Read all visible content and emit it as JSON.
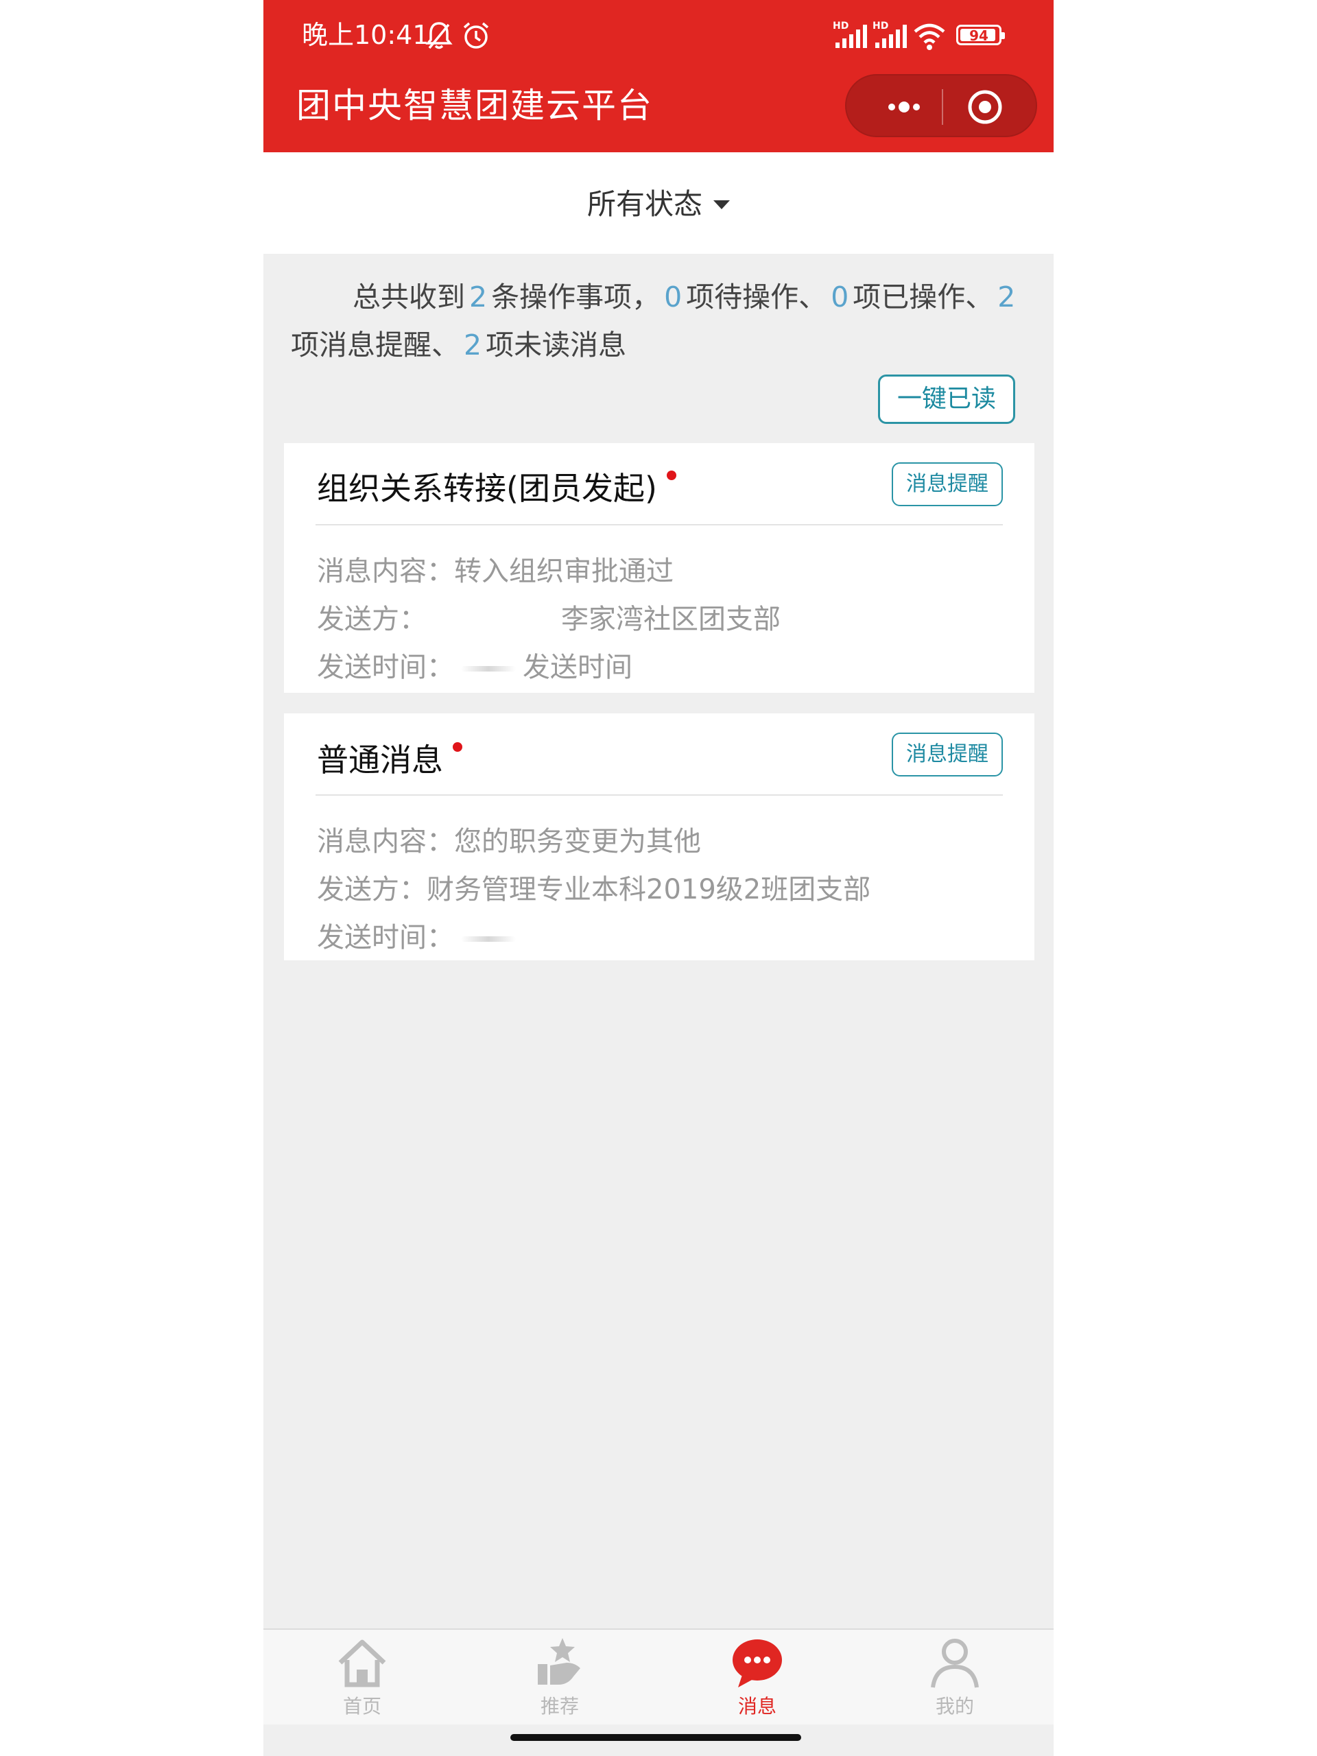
{
  "status_bar": {
    "time": "晚上10:41",
    "battery": "94",
    "hd1": "HD",
    "hd2": "HD"
  },
  "header": {
    "title": "团中央智慧团建云平台"
  },
  "filter": {
    "label": "所有状态"
  },
  "summary": {
    "prefix": "总共收到",
    "total": "2",
    "s1": "条操作事项，",
    "pending": "0",
    "s2": "项待操作、",
    "done": "0",
    "s3": "项已操作、",
    "reminders": "2",
    "s4": "项消息提醒、",
    "unread": "2",
    "s5": "项未读消息"
  },
  "read_all_button": "一键已读",
  "messages": [
    {
      "title": "组织关系转接(团员发起)",
      "badge": "消息提醒",
      "content_label": "消息内容：",
      "content": "转入组织审批通过",
      "sender_label": "发送方：",
      "sender": "李家湾社区团支部",
      "time_label": "发送时间：",
      "time": "发送时间"
    },
    {
      "title": "普通消息",
      "badge": "消息提醒",
      "content_label": "消息内容：",
      "content": "您的职务变更为其他",
      "sender_label": "发送方：",
      "sender": "财务管理专业本科2019级2班团支部",
      "time_label": "发送时间："
    }
  ],
  "tabbar": {
    "items": [
      {
        "label": "首页",
        "icon": "home-icon"
      },
      {
        "label": "推荐",
        "icon": "recommend-icon"
      },
      {
        "label": "消息",
        "icon": "message-icon",
        "active": true
      },
      {
        "label": "我的",
        "icon": "user-icon"
      }
    ]
  },
  "colors": {
    "brand_red": "#e02622",
    "accent_blue": "#5aa3cc",
    "badge_teal": "#2a94a6"
  }
}
